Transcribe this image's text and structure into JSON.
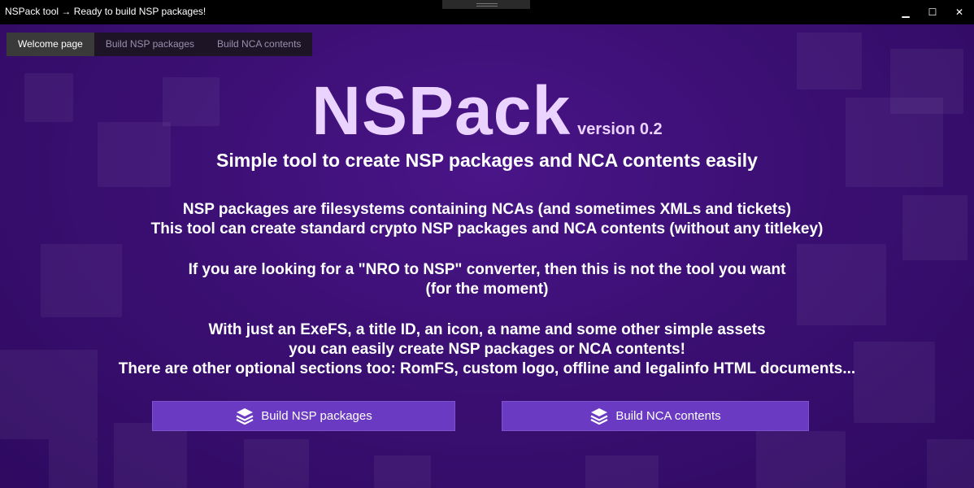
{
  "window": {
    "title": "NSPack tool → Ready to build NSP packages!",
    "controls": [
      "minimize-icon",
      "maximize-icon",
      "close-icon"
    ],
    "minimize_glyph": "▁",
    "maximize_glyph": "☐",
    "close_glyph": "✕"
  },
  "tabs": [
    {
      "label": "Welcome page",
      "active": true
    },
    {
      "label": "Build NSP packages",
      "active": false
    },
    {
      "label": "Build NCA contents",
      "active": false
    }
  ],
  "hero": {
    "app_name": "NSPack",
    "version": "version 0.2",
    "subtitle": "Simple tool to create NSP packages and NCA contents easily"
  },
  "paragraphs": {
    "p1": [
      "NSP packages are filesystems containing NCAs (and sometimes XMLs and tickets)",
      "This tool can create standard crypto NSP packages and NCA contents (without any titlekey)"
    ],
    "p2": [
      "If you are looking for a \"NRO to NSP\" converter, then this is not the tool you want",
      "(for the moment)"
    ],
    "p3": [
      "With just an ExeFS, a title ID, an icon, a name and some other simple assets",
      "you can easily create NSP packages or NCA contents!",
      "There are other optional sections too: RomFS, custom logo, offline and legalinfo HTML documents..."
    ]
  },
  "buttons": {
    "build_nsp": {
      "label": "Build NSP packages",
      "icon": "layers-icon"
    },
    "build_nca": {
      "label": "Build NCA contents",
      "icon": "layers-icon"
    }
  },
  "colors": {
    "background": "#3b0f73",
    "titlebar": "#000000",
    "accent_button": "#6b3ac2",
    "hero_text": "#ead3ff"
  }
}
